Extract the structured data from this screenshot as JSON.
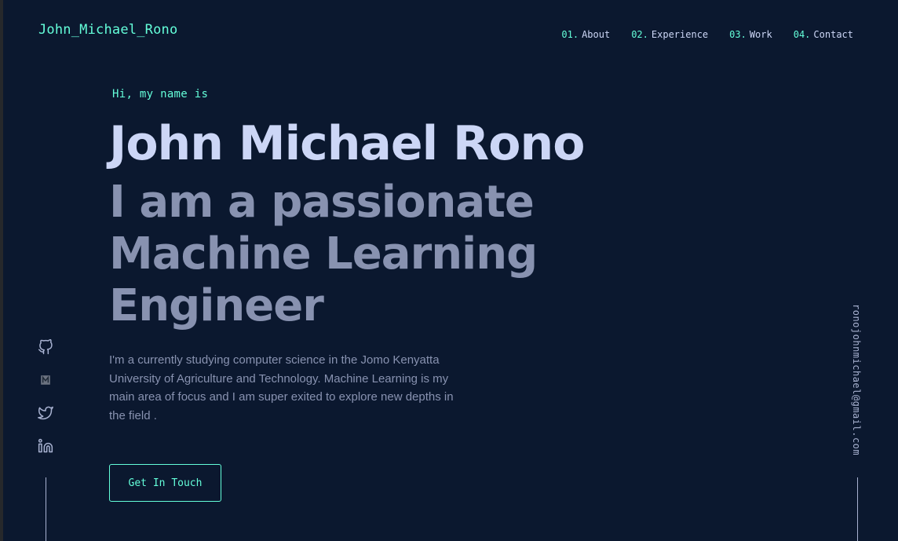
{
  "brand": {
    "logo_text": "John_Michael_Rono"
  },
  "nav": {
    "items": [
      {
        "num": "01.",
        "label": "About"
      },
      {
        "num": "02.",
        "label": "Experience"
      },
      {
        "num": "03.",
        "label": "Work"
      },
      {
        "num": "04.",
        "label": "Contact"
      }
    ]
  },
  "hero": {
    "intro": "Hi, my name is",
    "name": "John Michael Rono",
    "tagline": "I am a passionate Machine Learning Engineer",
    "bio": "I'm a currently studying computer science in the Jomo Kenyatta University of Agriculture and Technology. Machine Learning is my main area of focus and I am super exited to explore new depths in the field .",
    "cta_label": "Get In Touch"
  },
  "social": {
    "icons": [
      "github-icon",
      "medium-icon",
      "twitter-icon",
      "linkedin-icon"
    ]
  },
  "sidebar": {
    "email": "ronojohnmichael@gmail.com"
  },
  "colors": {
    "background": "#0b182f",
    "accent": "#64ffda",
    "heading": "#ccd6f6",
    "body_text": "#8892b0"
  }
}
